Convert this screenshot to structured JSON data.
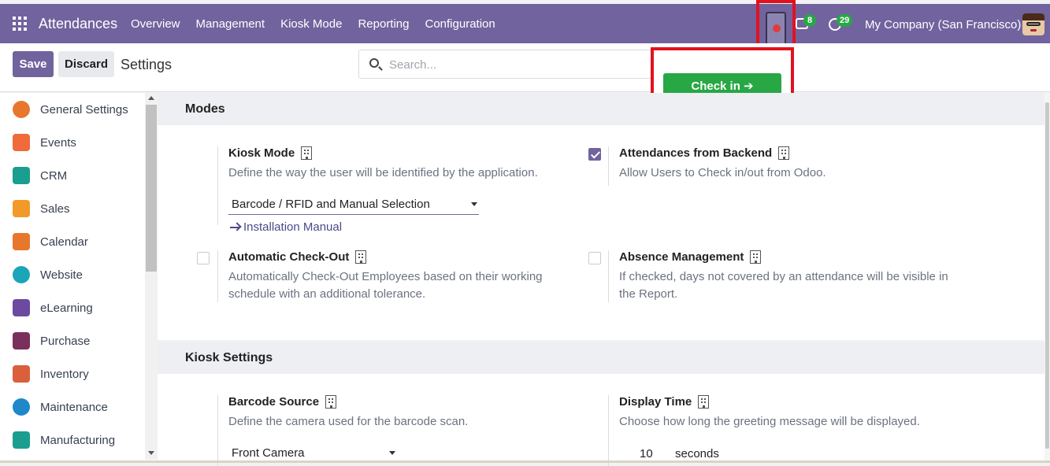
{
  "navbar": {
    "app_name": "Attendances",
    "menu": [
      "Overview",
      "Management",
      "Kiosk Mode",
      "Reporting",
      "Configuration"
    ],
    "chat_badge": "8",
    "activity_badge": "29",
    "company": "My Company (San Francisco)"
  },
  "control": {
    "save_label": "Save",
    "discard_label": "Discard",
    "breadcrumb": "Settings",
    "search_placeholder": "Search..."
  },
  "checkin": {
    "label": "Check in ➔"
  },
  "sidebar": {
    "items": [
      {
        "label": "General Settings",
        "icon": "general-settings-icon",
        "color": "#e8772e"
      },
      {
        "label": "Events",
        "icon": "events-icon",
        "color": "#f06a3c"
      },
      {
        "label": "CRM",
        "icon": "crm-icon",
        "color": "#1a9e8f"
      },
      {
        "label": "Sales",
        "icon": "sales-icon",
        "color": "#f19a2a"
      },
      {
        "label": "Calendar",
        "icon": "calendar-icon",
        "color": "#e8772e"
      },
      {
        "label": "Website",
        "icon": "website-icon",
        "color": "#1aa5b8"
      },
      {
        "label": "eLearning",
        "icon": "elearning-icon",
        "color": "#6b4aa0"
      },
      {
        "label": "Purchase",
        "icon": "purchase-icon",
        "color": "#7a2f5c"
      },
      {
        "label": "Inventory",
        "icon": "inventory-icon",
        "color": "#d9603b"
      },
      {
        "label": "Maintenance",
        "icon": "maintenance-icon",
        "color": "#1e88c9"
      },
      {
        "label": "Manufacturing",
        "icon": "manufacturing-icon",
        "color": "#1a9e8f"
      }
    ]
  },
  "modes": {
    "title": "Modes",
    "kiosk_mode": {
      "title": "Kiosk Mode",
      "desc": "Define the way the user will be identified by the application.",
      "value": "Barcode / RFID and Manual Selection",
      "link": "Installation Manual"
    },
    "backend": {
      "title": "Attendances from Backend",
      "desc": "Allow Users to Check in/out from Odoo.",
      "checked": true
    },
    "auto_checkout": {
      "title": "Automatic Check-Out",
      "desc": "Automatically Check-Out Employees based on their working schedule with an additional tolerance.",
      "checked": false
    },
    "absence": {
      "title": "Absence Management",
      "desc": "If checked, days not covered by an attendance will be visible in the Report.",
      "checked": false
    }
  },
  "kiosk_settings": {
    "title": "Kiosk Settings",
    "barcode_source": {
      "title": "Barcode Source",
      "desc": "Define the camera used for the barcode scan.",
      "value": "Front Camera"
    },
    "display_time": {
      "title": "Display Time",
      "desc": "Choose how long the greeting message will be displayed.",
      "value": "10",
      "unit": "seconds"
    }
  }
}
